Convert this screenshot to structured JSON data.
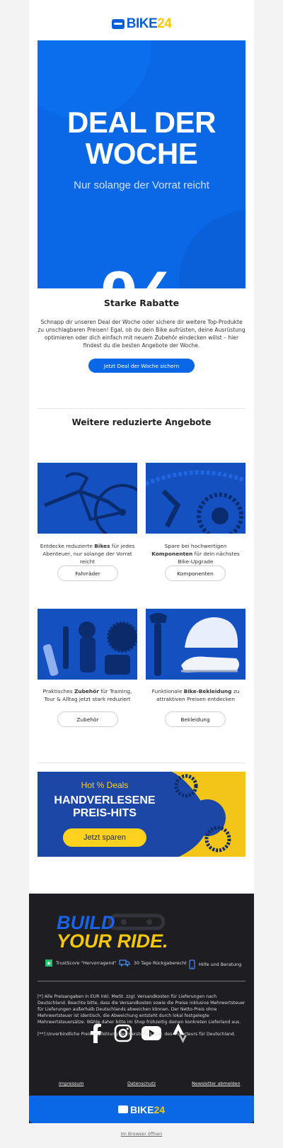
{
  "brand": {
    "logo_text": "BIKE",
    "logo_num": "24"
  },
  "hero": {
    "title_line1": "DEAL DER",
    "title_line2": "WOCHE",
    "subtitle": "Nur solange der Vorrat reicht",
    "percent": "%"
  },
  "intro": {
    "heading": "Starke Rabatte",
    "text": "Schnapp dir unseren Deal der Woche oder sichere dir weitere Top-Produkte zu unschlagbaren Preisen! Egal, ob du dein Bike aufrüsten, deine Ausrüstung optimieren oder dich einfach mit neuem Zubehör eindecken willst – hier findest du die besten Angebote der Woche.",
    "cta": "Jetzt Deal der Woche sichern"
  },
  "more": {
    "heading": "Weitere reduzierte Angebote"
  },
  "tiles": [
    {
      "pre": "Entdecke reduzierte ",
      "bold": "Bikes",
      "post": " für jedes Abenteuer, nur solange der Vorrat reicht",
      "button": "Fahrräder",
      "image": "bicycle-image"
    },
    {
      "pre": "Spare bei hochwertigen ",
      "bold": "Komponenten",
      "post": " für dein nächstes Bike-Upgrade",
      "button": "Komponenten",
      "image": "components-image"
    },
    {
      "pre": "Praktisches ",
      "bold": "Zubehör",
      "post": " für Training, Tour & Alltag jetzt stark reduziert",
      "button": "Zubehör",
      "image": "accessories-image"
    },
    {
      "pre": "Funktionale ",
      "bold": "Bike-Bekleidung",
      "post": " zu attraktiven Preisen entdecken",
      "button": "Bekleidung",
      "image": "apparel-image"
    }
  ],
  "banner": {
    "kicker": "Hot % Deals",
    "headline_line1": "HANDVERLESENE",
    "headline_line2": "PREIS-HITS",
    "cta": "Jetzt sparen"
  },
  "footer": {
    "slogan_line1": "BUILD",
    "slogan_line2": "YOUR RIDE.",
    "trust": [
      {
        "icon": "star-icon",
        "label": "TrustScore \"Hervorragend\""
      },
      {
        "icon": "truck-icon",
        "label": "30 Tage Rückgaberecht"
      },
      {
        "icon": "phone-icon",
        "label": "Hilfe und Beratung"
      }
    ],
    "legal1": "[*] Alle Preisangaben in EUR inkl. MwSt. zzgl. Versandkosten für Lieferungen nach Deutschland. Beachte bitte, dass die Versandkosten sowie die Preise inklusive Mehrwertsteuer für Lieferungen außerhalb Deutschlands abweichen können. Der Netto-Preis ohne Mehrwertsteuer ist identisch, die Abweichung entsteht durch lokal festgelegte Mehrwertsteuersätze. Wähle daher bitte im Shop frühzeitig deinen konkreten Lieferland aus.",
    "legal2": "[**] Unverbindliche Preisempfehlung des Herstellers bzw. des Importeurs für Deutschland.",
    "social": [
      "facebook-icon",
      "instagram-icon",
      "youtube-icon",
      "strava-icon"
    ],
    "links": [
      "Impressum",
      "Datenschutz",
      "Newsletter abmelden"
    ]
  },
  "browser_link": "Im Browser öffnen",
  "colors": {
    "primary": "#0a68e6",
    "accent": "#f7c700",
    "footer_bg": "#1d1d22"
  }
}
